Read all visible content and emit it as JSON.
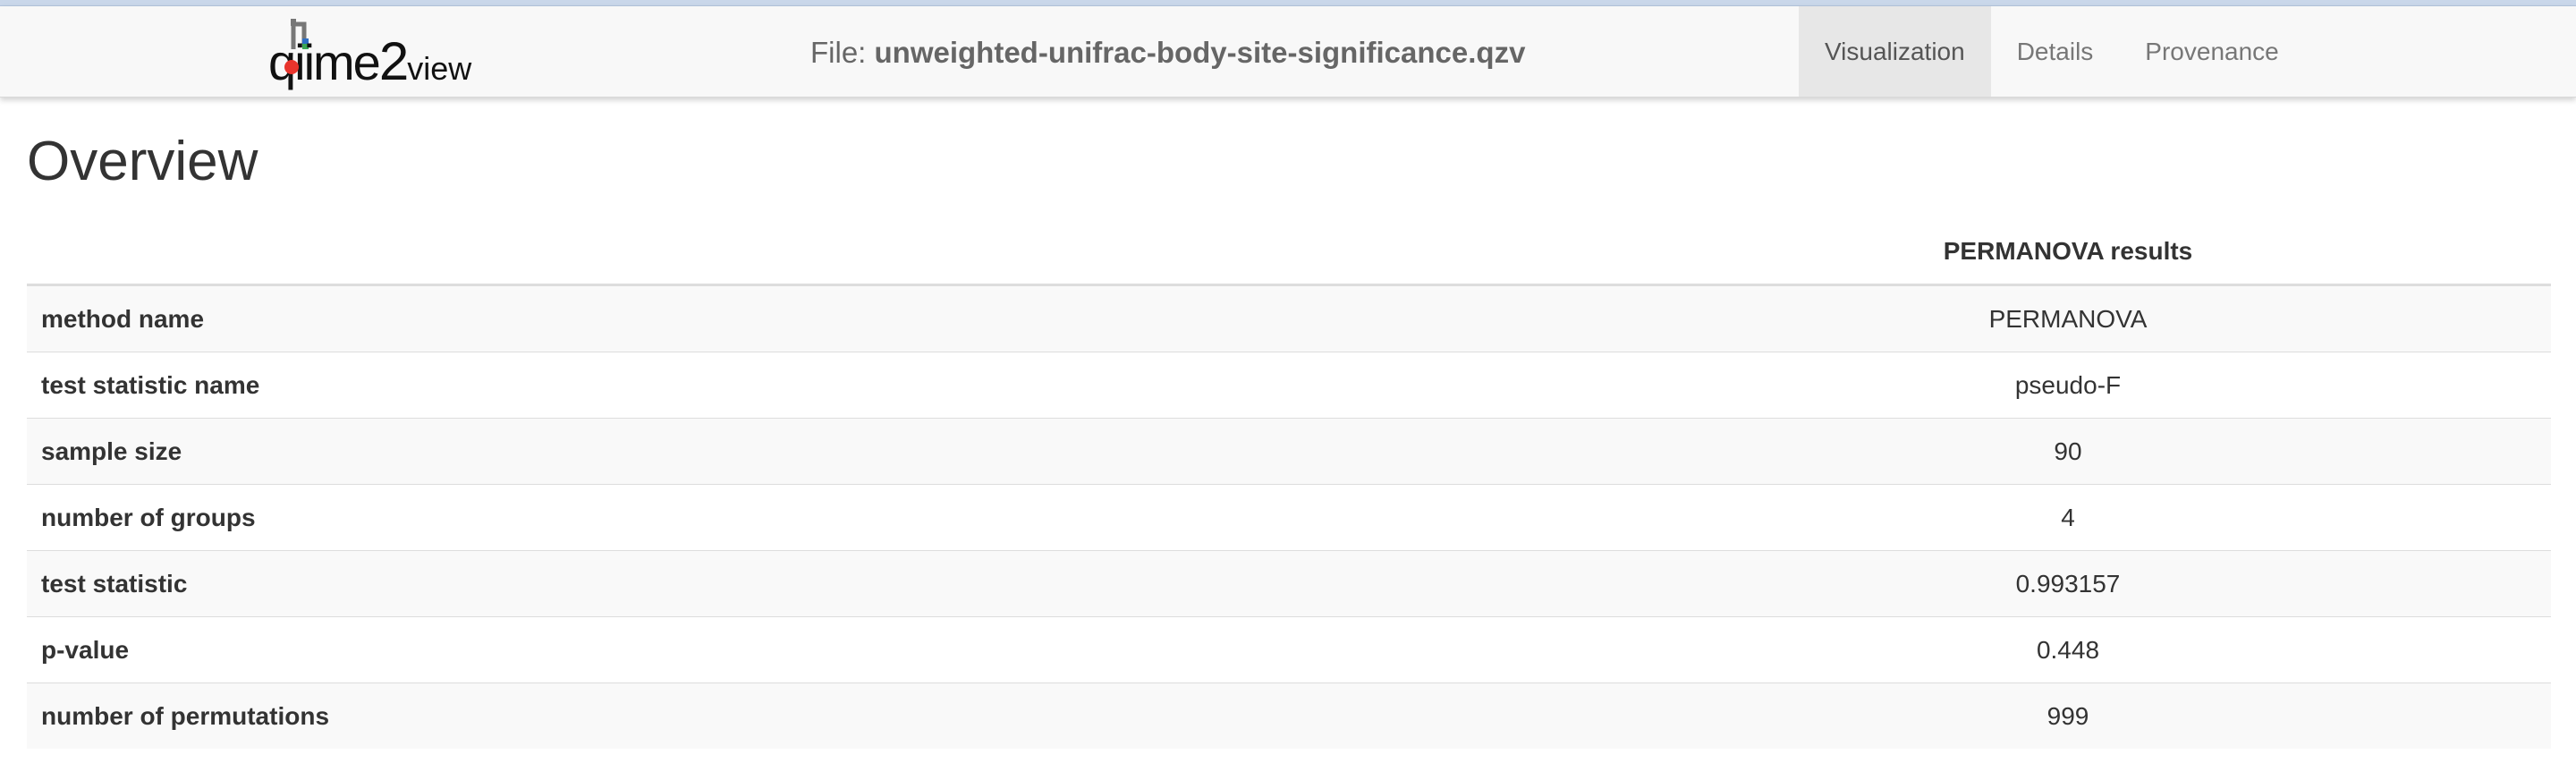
{
  "navbar": {
    "logo": {
      "text_q": "qiime",
      "text_two": "2",
      "text_view": "view"
    },
    "file_prefix": "File: ",
    "file_name": "unweighted-unifrac-body-site-significance.qzv",
    "tabs": [
      {
        "label": "Visualization",
        "active": true
      },
      {
        "label": "Details",
        "active": false
      },
      {
        "label": "Provenance",
        "active": false
      }
    ]
  },
  "main": {
    "heading": "Overview",
    "table": {
      "column_header": "PERMANOVA results",
      "rows": [
        {
          "key": "method name",
          "value": "PERMANOVA"
        },
        {
          "key": "test statistic name",
          "value": "pseudo-F"
        },
        {
          "key": "sample size",
          "value": "90"
        },
        {
          "key": "number of groups",
          "value": "4"
        },
        {
          "key": "test statistic",
          "value": "0.993157"
        },
        {
          "key": "p-value",
          "value": "0.448"
        },
        {
          "key": "number of permutations",
          "value": "999"
        }
      ]
    }
  },
  "colors": {
    "navbar_bg": "#f8f8f8",
    "active_tab_bg": "#e7e7e7",
    "logo_red": "#e8342c",
    "logo_green": "#3aa655",
    "logo_blue": "#2f6fc4",
    "logo_gray": "#777777"
  },
  "icons": {
    "logo": "qiime2-logo-mark"
  }
}
